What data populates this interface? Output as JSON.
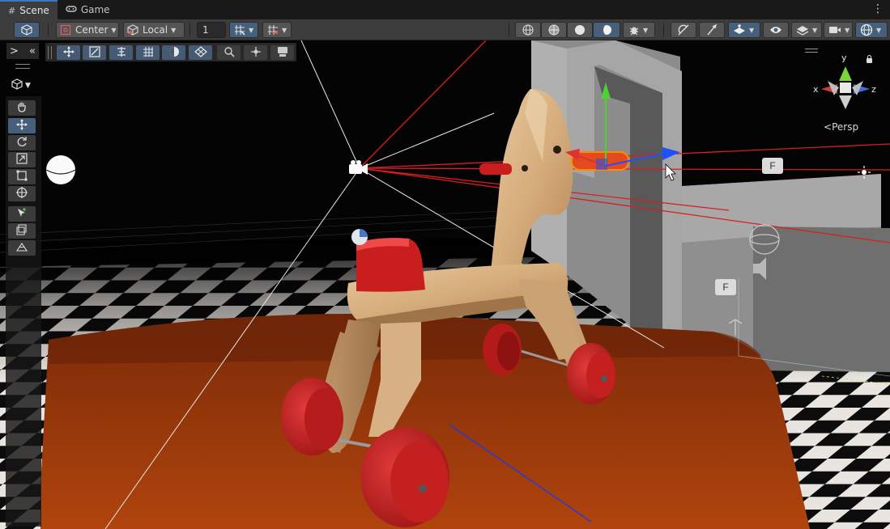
{
  "tabs": [
    {
      "label": "Scene",
      "icon": "grid-icon",
      "active": true
    },
    {
      "label": "Game",
      "icon": "gamepad-icon",
      "active": false
    }
  ],
  "toolbar": {
    "pivot_mode": "Center",
    "pivot_rotation": "Local",
    "grid_snap_value": "1"
  },
  "overlay": {
    "collapse_left": ">",
    "collapse_right": "«"
  },
  "gizmo": {
    "y_label": "y",
    "x_label": "x",
    "z_label": "z",
    "projection": "Persp"
  },
  "scene_labels": {
    "focus_key_1": "F",
    "focus_key_2": "F"
  },
  "colors": {
    "accent": "#46607c",
    "tab_highlight": "#3a79bb",
    "toolbar_bg": "#3c3c3c",
    "axis_x": "#d23b3b",
    "axis_y": "#7cd23a",
    "axis_z": "#3c6ee0"
  }
}
